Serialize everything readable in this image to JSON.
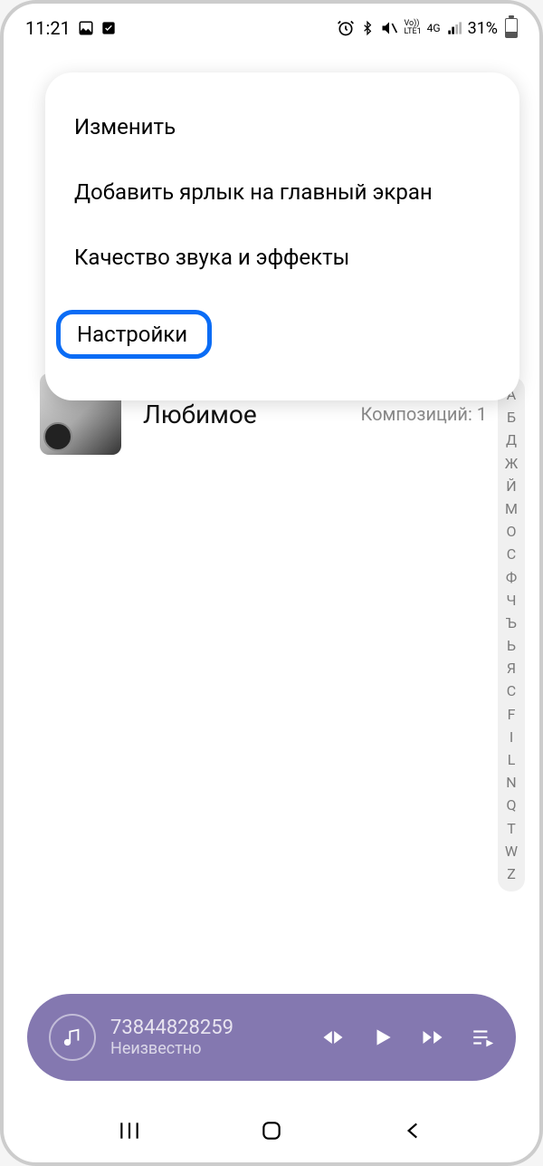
{
  "status_bar": {
    "time": "11:21",
    "battery_text": "31%",
    "signal_label": "4G",
    "volte_label": "Vo))\nLTE1"
  },
  "menu": {
    "items": [
      {
        "label": "Изменить"
      },
      {
        "label": "Добавить ярлык на главный экран"
      },
      {
        "label": "Качество звука и эффекты"
      },
      {
        "label": "Настройки"
      }
    ]
  },
  "playlist": {
    "title": "Любимое",
    "count_label": "Композиций: 1"
  },
  "alpha_index": [
    "А",
    "Б",
    "Д",
    "Ж",
    "Й",
    "М",
    "О",
    "С",
    "Ф",
    "Ч",
    "Ъ",
    "Ь",
    "Я",
    "C",
    "F",
    "I",
    "L",
    "N",
    "Q",
    "T",
    "W",
    "Z"
  ],
  "now_playing": {
    "title": "73844828259",
    "artist": "Неизвестно"
  },
  "icons": {
    "music_note": "♪",
    "prev": "prev-icon",
    "play": "play-icon",
    "next": "next-icon",
    "queue": "queue-icon"
  }
}
